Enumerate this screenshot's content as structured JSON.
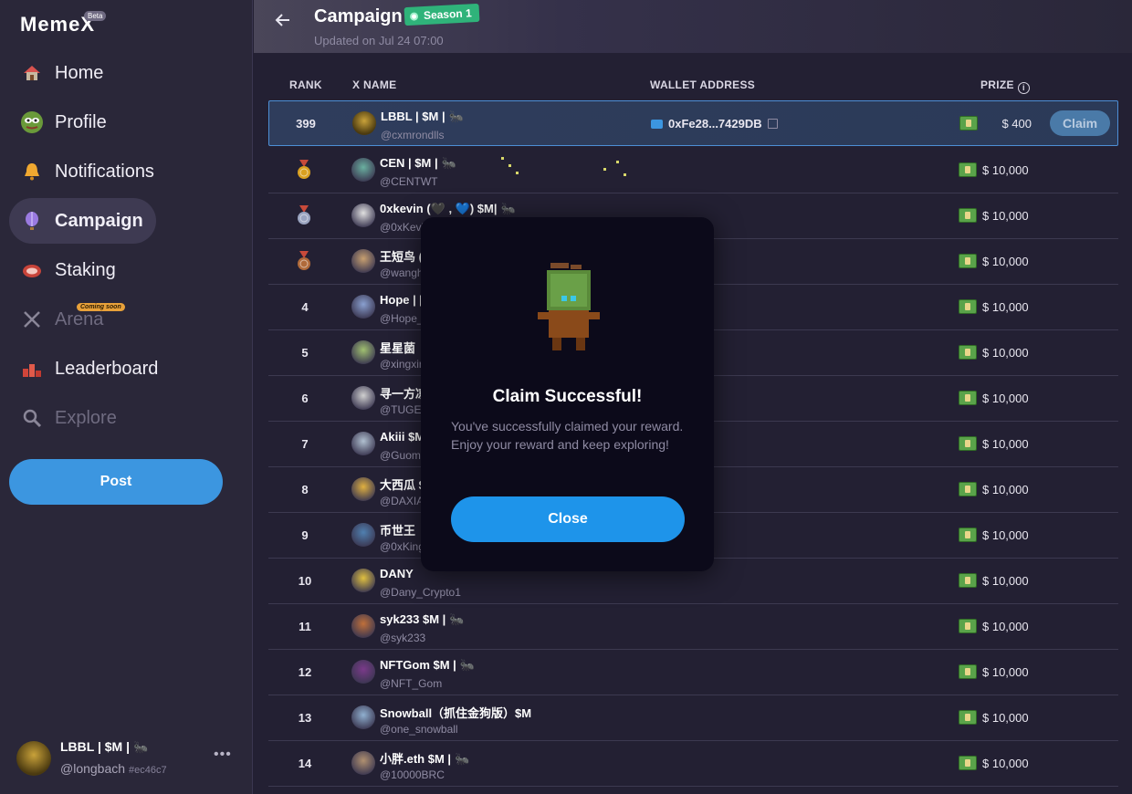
{
  "app": {
    "logo": "MemeX",
    "beta": "Beta"
  },
  "sidebar": {
    "items": [
      {
        "label": "Home",
        "icon": "house-icon",
        "state": "normal"
      },
      {
        "label": "Profile",
        "icon": "pepe-icon",
        "state": "normal"
      },
      {
        "label": "Notifications",
        "icon": "bell-icon",
        "state": "normal"
      },
      {
        "label": "Campaign",
        "icon": "balloon-icon",
        "state": "active"
      },
      {
        "label": "Staking",
        "icon": "steak-icon",
        "state": "normal"
      },
      {
        "label": "Arena",
        "icon": "crossed-swords-icon",
        "state": "disabled"
      },
      {
        "label": "Leaderboard",
        "icon": "podium-icon",
        "state": "normal"
      },
      {
        "label": "Explore",
        "icon": "magnifier-icon",
        "state": "disabled"
      }
    ],
    "coming_soon": "Coming soon",
    "post_label": "Post",
    "profile": {
      "name": "LBBL | $M |",
      "handle": "@longbach",
      "hash": "#ec46c7",
      "more": "•••"
    }
  },
  "header": {
    "title": "Campaign",
    "season": "Season 1",
    "updated": "Updated on Jul 24 07:00"
  },
  "table": {
    "columns": {
      "rank": "RANK",
      "xname": "X NAME",
      "wallet": "WALLET ADDRESS",
      "prize": "PRIZE"
    },
    "my_row": {
      "rank": "399",
      "name": "LBBL | $M |",
      "handle": "@cxmrondlls",
      "wallet": "0xFe28...7429DB",
      "prize": "$ 400",
      "claim": "Claim"
    },
    "rows": [
      {
        "rank": "",
        "medal": "gold",
        "name": "CEN | $M |",
        "handle": "@CENTWT",
        "prize": "$ 10,000",
        "ant": true
      },
      {
        "rank": "",
        "medal": "silver",
        "name": "0xkevin (🖤 , 💙) $M|",
        "handle": "@0xKevi",
        "prize": "$ 10,000",
        "ant": true
      },
      {
        "rank": "",
        "medal": "bronze",
        "name": "王短鸟 (",
        "handle": "@wangh",
        "prize": "$ 10,000",
        "ant": false
      },
      {
        "rank": "4",
        "name": "Hope | [",
        "handle": "@Hope_",
        "prize": "$ 10,000",
        "ant": false
      },
      {
        "rank": "5",
        "name": "星星菌",
        "handle": "@xingxir",
        "prize": "$ 10,000",
        "ant": false
      },
      {
        "rank": "6",
        "name": "寻一方凉",
        "handle": "@TUGE8",
        "prize": "$ 10,000",
        "ant": false
      },
      {
        "rank": "7",
        "name": "Akiii $M",
        "handle": "@Guomi",
        "prize": "$ 10,000",
        "ant": false
      },
      {
        "rank": "8",
        "name": "大西瓜 $",
        "handle": "@DAXIA",
        "prize": "$ 10,000",
        "ant": false
      },
      {
        "rank": "9",
        "name": "币世王",
        "handle": "@0xKing",
        "prize": "$ 10,000",
        "ant": false
      },
      {
        "rank": "10",
        "name": "DANY",
        "handle": "@Dany_Crypto1",
        "prize": "$ 10,000",
        "ant": false
      },
      {
        "rank": "11",
        "name": "syk233 $M |",
        "handle": "@syk233",
        "prize": "$ 10,000",
        "ant": true
      },
      {
        "rank": "12",
        "name": "NFTGom $M |",
        "handle": "@NFT_Gom",
        "prize": "$ 10,000",
        "ant": true
      },
      {
        "rank": "13",
        "name": "Snowball（抓住金狗版）$M",
        "handle": "@one_snowball",
        "prize": "$ 10,000",
        "ant": false
      },
      {
        "rank": "14",
        "name": "小胖.eth $M |",
        "handle": "@10000BRC",
        "prize": "$ 10,000",
        "ant": true
      }
    ]
  },
  "modal": {
    "title": "Claim Successful!",
    "text": "You've successfully claimed your reward. Enjoy your reward and keep exploring!",
    "close_label": "Close"
  },
  "colors": {
    "accent": "#1e94ea",
    "season_badge": "#2fb37a",
    "highlight_border": "#4d8fd6"
  }
}
